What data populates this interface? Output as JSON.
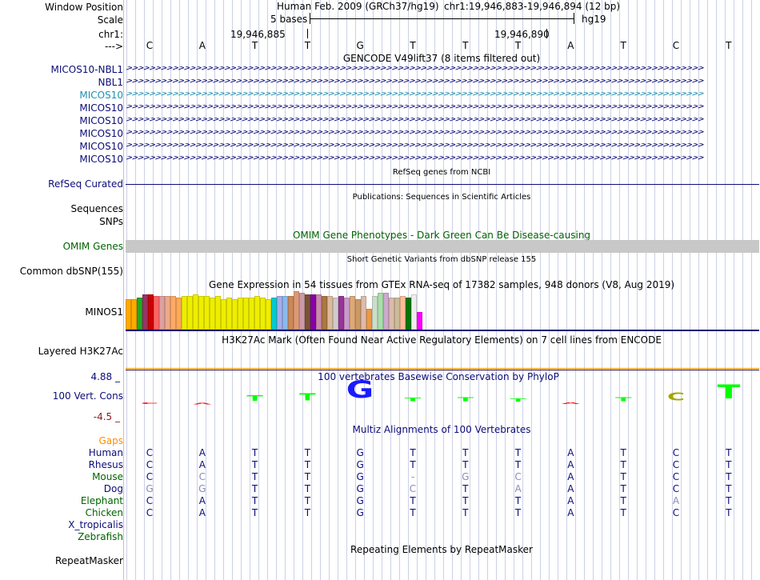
{
  "header": {
    "window_position_label": "Window Position",
    "scale_label": "Scale",
    "chr_label": "chr1:",
    "strand_label": "--->",
    "assembly_title": "Human Feb. 2009 (GRCh37/hg19)",
    "position_text": "chr1:19,946,883-19,946,894 (12 bp)",
    "scale_text": "5 bases",
    "db_label": "hg19",
    "coord_1": "19,946,885",
    "coord_2": "19,946,890",
    "bases": [
      "C",
      "A",
      "T",
      "T",
      "G",
      "T",
      "T",
      "T",
      "A",
      "T",
      "C",
      "T"
    ]
  },
  "gencode": {
    "title": "GENCODE V49lift37 (8 items filtered out)",
    "items": [
      {
        "label": "MICOS10-NBL1",
        "color": "#0c0c78"
      },
      {
        "label": "NBL1",
        "color": "#0c0c78"
      },
      {
        "label": "MICOS10",
        "color": "#1e90b0"
      },
      {
        "label": "MICOS10",
        "color": "#0c0c78"
      },
      {
        "label": "MICOS10",
        "color": "#0c0c78"
      },
      {
        "label": "MICOS10",
        "color": "#0c0c78"
      },
      {
        "label": "MICOS10",
        "color": "#0c0c78"
      },
      {
        "label": "MICOS10",
        "color": "#0c0c78"
      }
    ],
    "chevrons": ">>>>>>>>>>>>>>>>>>>>>>>>>>>>>>>>>>>>>>>>>>>>>>>>>>>>>>>>>>>>>>>>>>>>>>>>>>>>>>>>>>>>>>>>>>>>>>>>>>>>"
  },
  "refseq": {
    "title": "RefSeq genes from NCBI",
    "label": "RefSeq Curated",
    "color": "#0c0c78"
  },
  "publications": {
    "title": "Publications: Sequences in Scientific Articles"
  },
  "sequences_label": "Sequences",
  "snps_label": "SNPs",
  "omim": {
    "title": "OMIM Gene Phenotypes - Dark Green Can Be Disease-causing",
    "label": "OMIM Genes",
    "color": "#006400"
  },
  "dbsnp": {
    "title": "Short Genetic Variants from dbSNP release 155",
    "label": "Common dbSNP(155)"
  },
  "gtex": {
    "title": "Gene Expression in 54 tissues from GTEx RNA-seq of 17382 samples, 948 donors (V8, Aug 2019)",
    "label": "MINOS1",
    "bar_colors": [
      "#ffaa00",
      "#ffaa00",
      "#22aa22",
      "#993366",
      "#cc0000",
      "#ff6666",
      "#dda0a0",
      "#eeaa88",
      "#ffaa66",
      "#ffaa55",
      "#eeee00",
      "#eeee00",
      "#eeee00",
      "#eeee00",
      "#eeee00",
      "#eeee00",
      "#eeee00",
      "#eeee00",
      "#eeee00",
      "#eeee00",
      "#eeee00",
      "#eeee00",
      "#eeee00",
      "#eeee00",
      "#eeee00",
      "#eeee00",
      "#00cccc",
      "#aaaaee",
      "#88bbee",
      "#cc8855",
      "#dd9977",
      "#cc99aa",
      "#775533",
      "#8800aa",
      "#cc88aa",
      "#aa7744",
      "#ddbb99",
      "#cccccc",
      "#993399",
      "#cc99cc",
      "#ddaa77",
      "#cc9966",
      "#ddbbaa",
      "#ee9944",
      "#ccddcc",
      "#aaddaa",
      "#ccaacc",
      "#ddbbaa",
      "#ccbb99",
      "#ffbb99",
      "#007700",
      "#eeeeee",
      "#ff00ff"
    ],
    "bar_values": [
      36,
      36,
      38,
      42,
      42,
      40,
      40,
      40,
      40,
      38,
      40,
      40,
      42,
      40,
      40,
      38,
      40,
      36,
      38,
      36,
      38,
      38,
      38,
      40,
      38,
      36,
      38,
      40,
      40,
      40,
      46,
      44,
      42,
      42,
      42,
      40,
      40,
      38,
      40,
      38,
      40,
      36,
      40,
      24,
      40,
      44,
      44,
      38,
      38,
      40,
      38,
      42,
      20
    ]
  },
  "h3k27ac": {
    "title": "H3K27Ac Mark (Often Found Near Active Regulatory Elements) on 7 cell lines from ENCODE",
    "label": "Layered H3K27Ac"
  },
  "phylop": {
    "title": "100 vertebrates Basewise Conservation by PhyloP",
    "label": "100 Vert. Cons",
    "ymax": "4.88 _",
    "ymin": "-4.5 _",
    "scores": [
      -0.05,
      -0.35,
      1.2,
      1.5,
      3.6,
      0.8,
      0.9,
      0.7,
      -0.25,
      0.9,
      1.6,
      3.0
    ],
    "colors": {
      "positive": "#00ff00",
      "neutral": "#ff0000",
      "gc": "#1a1aff",
      "c_olive": "#a6a600"
    }
  },
  "multiz": {
    "title": "Multiz Alignments of 100 Vertebrates",
    "gaps_label": "Gaps",
    "species": [
      {
        "name": "Human",
        "color": "#0c0c78",
        "bases": [
          "C",
          "A",
          "T",
          "T",
          "G",
          "T",
          "T",
          "T",
          "A",
          "T",
          "C",
          "T"
        ]
      },
      {
        "name": "Rhesus",
        "color": "#0c0c78",
        "bases": [
          "C",
          "A",
          "T",
          "T",
          "G",
          "T",
          "T",
          "T",
          "A",
          "T",
          "C",
          "T"
        ]
      },
      {
        "name": "Mouse",
        "color": "#006400",
        "bases": [
          "C",
          "C",
          "T",
          "T",
          "G",
          "-",
          "G",
          "C",
          "A",
          "T",
          "C",
          "T"
        ]
      },
      {
        "name": "Dog",
        "color": "#0c0c78",
        "bases": [
          "G",
          "G",
          "T",
          "T",
          "G",
          "C",
          "T",
          "A",
          "A",
          "T",
          "C",
          "T"
        ]
      },
      {
        "name": "Elephant",
        "color": "#006400",
        "bases": [
          "C",
          "A",
          "T",
          "T",
          "G",
          "T",
          "T",
          "T",
          "A",
          "T",
          "A",
          "T"
        ]
      },
      {
        "name": "Chicken",
        "color": "#006400",
        "bases": [
          "C",
          "A",
          "T",
          "T",
          "G",
          "T",
          "T",
          "T",
          "A",
          "T",
          "C",
          "T"
        ]
      },
      {
        "name": "X_tropicalis",
        "color": "#0c0c78",
        "bases": []
      },
      {
        "name": "Zebrafish",
        "color": "#006400",
        "bases": []
      }
    ],
    "mismatch": [
      [
        false,
        false,
        false,
        false,
        false,
        false,
        false,
        false,
        false,
        false,
        false,
        false
      ],
      [
        false,
        false,
        false,
        false,
        false,
        false,
        false,
        false,
        false,
        false,
        false,
        false
      ],
      [
        false,
        true,
        false,
        false,
        false,
        true,
        true,
        true,
        false,
        false,
        false,
        false
      ],
      [
        true,
        true,
        false,
        false,
        false,
        true,
        false,
        true,
        false,
        false,
        false,
        false
      ],
      [
        false,
        false,
        false,
        false,
        false,
        false,
        false,
        false,
        false,
        false,
        true,
        false
      ],
      [
        false,
        false,
        false,
        false,
        false,
        false,
        false,
        false,
        false,
        false,
        false,
        false
      ]
    ]
  },
  "repeatmasker": {
    "title": "Repeating Elements by RepeatMasker",
    "label": "RepeatMasker"
  },
  "colors": {
    "navy": "#0c0c78",
    "grid": "#ccd0e4",
    "divider": "#ffa8a8",
    "orange": "#ff8c00",
    "gray_bar": "#c8c8c8",
    "h3_line": "#0c0c78"
  }
}
